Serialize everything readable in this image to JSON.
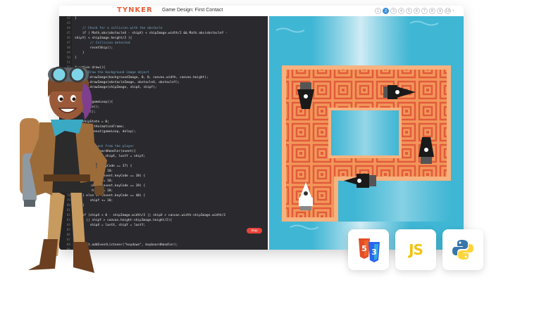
{
  "app": {
    "logo": "TYNKER",
    "title": "Game Design: First Contact"
  },
  "pagination": {
    "active": "2",
    "pages": [
      "1",
      "2",
      "3",
      "4",
      "5",
      "6",
      "7",
      "8",
      "9",
      "10"
    ],
    "next": "›"
  },
  "editor": {
    "lines": [
      {
        "n": "42",
        "t": "}"
      },
      {
        "n": "43",
        "t": ""
      },
      {
        "n": "44",
        "t": "    // Check for a collision with the obstacle"
      },
      {
        "n": "45",
        "t": "    if ( Math.abs(obstacleX - shipX) < shipImage.width/2 && Math.abs(obstacleY -"
      },
      {
        "n": "46",
        "t": "shipY) < shipImage.height/2 ){"
      },
      {
        "n": "47",
        "t": "        // Collision detected"
      },
      {
        "n": "48",
        "t": "        resetShip();"
      },
      {
        "n": "49",
        "t": "    }"
      },
      {
        "n": "50",
        "t": "}"
      },
      {
        "n": "51",
        "t": ""
      },
      {
        "n": "52",
        "t": "function draw(){"
      },
      {
        "n": "53",
        "t": "    // Draw the background image object"
      },
      {
        "n": "54",
        "t": "    ctx.drawImage(backgroundImage, 0, 0, canvas.width, canvas.height);"
      },
      {
        "n": "55",
        "t": "    ctx.drawImage(obstacleImage, obstacleX, obstacleY);"
      },
      {
        "n": "56",
        "t": "    ctx.drawImage(shipImage, shipX, shipY);"
      },
      {
        "n": "57",
        "t": "}"
      },
      {
        "n": "58",
        "t": ""
      },
      {
        "n": "59",
        "t": "function gameLoop(){"
      },
      {
        "n": "60",
        "t": "    update();"
      },
      {
        "n": "61",
        "t": "    draw();"
      },
      {
        "n": "62",
        "t": ""
      },
      {
        "n": "63",
        "t": "    shipState = 0;"
      },
      {
        "n": "64",
        "t": "    requestAnimationFrame;"
      },
      {
        "n": "65",
        "t": "    setTimeout(gameLoop, delay);"
      },
      {
        "n": "66",
        "t": "}"
      },
      {
        "n": "67",
        "t": ""
      },
      {
        "n": "68",
        "t": "// Handle input from the player"
      },
      {
        "n": "69",
        "t": "function keyboardHandler(event){"
      },
      {
        "n": "70",
        "t": "    var lastX = shipX, lastY = shipY;"
      },
      {
        "n": "71",
        "t": ""
      },
      {
        "n": "72",
        "t": "    if (event.keyCode == 37) {"
      },
      {
        "n": "73",
        "t": "        shipX -= 10;"
      },
      {
        "n": "74",
        "t": "    } else if (event.keyCode == 38) {"
      },
      {
        "n": "75",
        "t": "        shipY -= 10;"
      },
      {
        "n": "76",
        "t": "    } else if (event.keyCode == 39) {"
      },
      {
        "n": "77",
        "t": "        shipX += 10;"
      },
      {
        "n": "78",
        "t": "    } else if (event.keyCode == 40) {"
      },
      {
        "n": "79",
        "t": "        shipY += 10;"
      },
      {
        "n": "80",
        "t": "    }"
      },
      {
        "n": "81",
        "t": ""
      },
      {
        "n": "82",
        "t": "    if (shipX < 0 - shipImage.width/2 || shipX > canvas.width-shipImage.width/2"
      },
      {
        "n": "83",
        "t": "      || shipY > canvas.height-shipImage.height/2){"
      },
      {
        "n": "84",
        "t": "        shipX = lastX, shipY = lastY;"
      },
      {
        "n": "85",
        "t": "    }"
      },
      {
        "n": "86",
        "t": "}"
      },
      {
        "n": "87",
        "t": ""
      },
      {
        "n": "88",
        "t": "document.addEventListener(\"keydown\", keyboardHandler);"
      },
      {
        "n": "89",
        "t": ""
      },
      {
        "n": "90",
        "t": ""
      },
      {
        "n": "91",
        "t": ""
      }
    ],
    "run_label": "Stop"
  },
  "languages": [
    {
      "name": "HTML5 / CSS3",
      "icon": "html5-css3-icon"
    },
    {
      "name": "JavaScript",
      "label": "JS",
      "icon": "javascript-icon"
    },
    {
      "name": "Python",
      "icon": "python-icon"
    }
  ],
  "colors": {
    "editor_bg": "#2a2a2e",
    "water": "#3fb6d4",
    "fortress": "#f2975a",
    "fortress_dark": "#e25a3c",
    "accent": "#3b8fd8",
    "js": "#f1c40f",
    "html": "#e44d26",
    "css": "#2965f1"
  }
}
